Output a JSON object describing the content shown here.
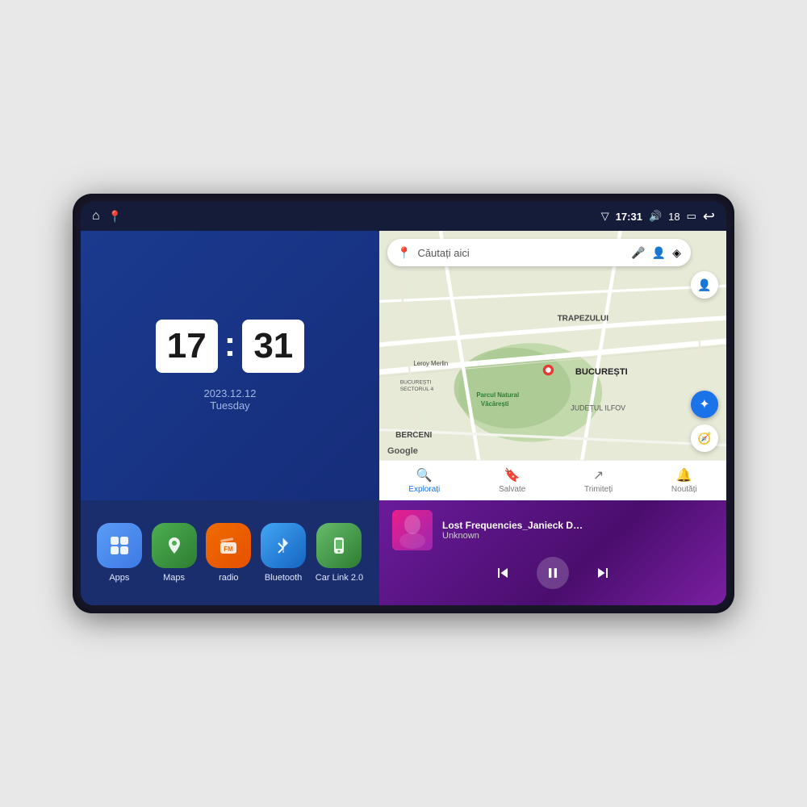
{
  "device": {
    "status_bar": {
      "left_icons": [
        "home-icon",
        "maps-pin-icon"
      ],
      "time": "17:31",
      "signal_icon": "signal-icon",
      "volume": "18",
      "battery_icon": "battery-icon",
      "back_icon": "back-icon"
    },
    "clock": {
      "hours": "17",
      "minutes": "31",
      "date": "2023.12.12",
      "day": "Tuesday"
    },
    "shortcuts": [
      {
        "id": "apps",
        "label": "Apps",
        "icon_class": "icon-apps",
        "icon_char": "⊞"
      },
      {
        "id": "maps",
        "label": "Maps",
        "icon_class": "icon-maps",
        "icon_char": "📍"
      },
      {
        "id": "radio",
        "label": "radio",
        "icon_class": "icon-radio",
        "icon_char": "📻"
      },
      {
        "id": "bluetooth",
        "label": "Bluetooth",
        "icon_class": "icon-bluetooth",
        "icon_char": "🔷"
      },
      {
        "id": "carlink",
        "label": "Car Link 2.0",
        "icon_class": "icon-carlink",
        "icon_char": "📱"
      }
    ],
    "map": {
      "search_placeholder": "Căutați aici",
      "bottom_nav": [
        {
          "icon": "🔍",
          "label": "Explorați",
          "active": true
        },
        {
          "icon": "🔖",
          "label": "Salvate",
          "active": false
        },
        {
          "icon": "↗",
          "label": "Trimiteți",
          "active": false
        },
        {
          "icon": "🔔",
          "label": "Noutăți",
          "active": false
        }
      ],
      "location_labels": [
        "TRAPEZULUI",
        "BUCUREȘTI",
        "JUDEȚUL ILFOV",
        "BERCENI",
        "Parcul Natural Văcărești",
        "Leroy Merlin",
        "BUCUREȘTI SECTORUL 4"
      ]
    },
    "music": {
      "title": "Lost Frequencies_Janieck Devy-...",
      "artist": "Unknown",
      "state": "playing"
    }
  }
}
